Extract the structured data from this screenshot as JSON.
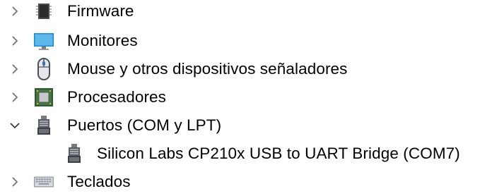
{
  "device_tree": {
    "items": [
      {
        "label": "Firmware",
        "expanded": false,
        "icon": "firmware-chip-icon"
      },
      {
        "label": "Monitores",
        "expanded": false,
        "icon": "monitor-icon"
      },
      {
        "label": "Mouse y otros dispositivos señaladores",
        "expanded": false,
        "icon": "mouse-icon"
      },
      {
        "label": "Procesadores",
        "expanded": false,
        "icon": "processor-icon"
      },
      {
        "label": "Puertos (COM y LPT)",
        "expanded": true,
        "icon": "port-connector-icon",
        "children": [
          {
            "label": "Silicon Labs CP210x USB to UART Bridge (COM7)",
            "icon": "port-connector-icon"
          }
        ]
      },
      {
        "label": "Teclados",
        "expanded": false,
        "icon": "keyboard-icon"
      }
    ]
  }
}
